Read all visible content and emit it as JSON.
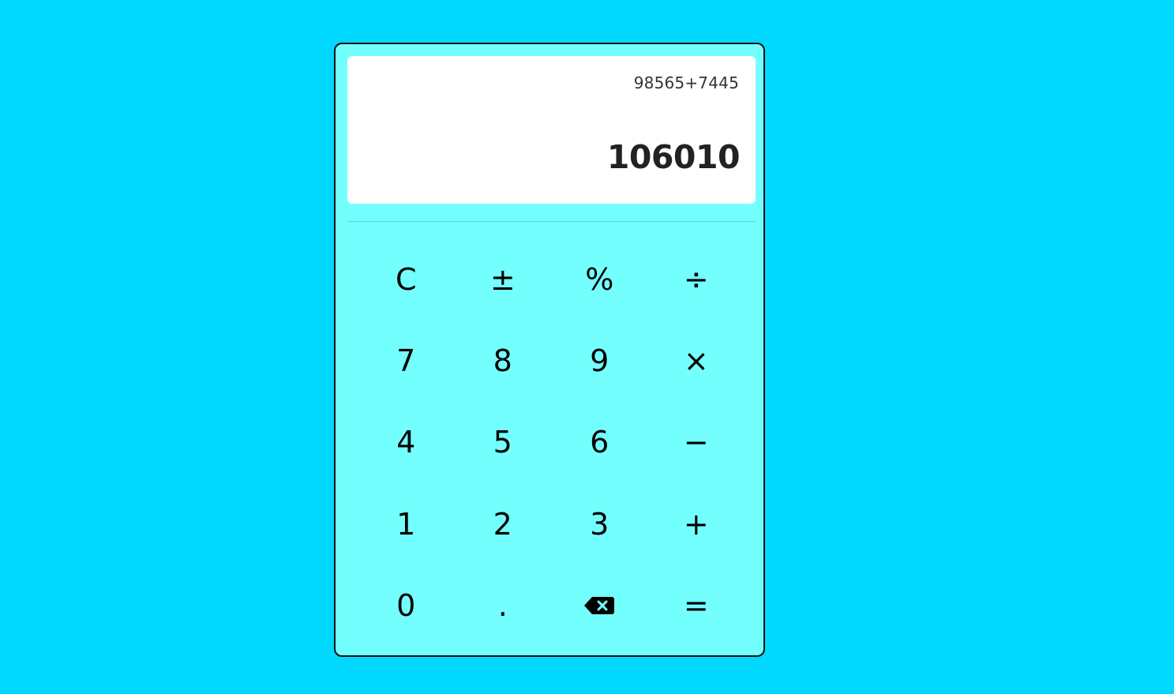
{
  "display": {
    "expression": "98565+7445",
    "result": "106010"
  },
  "keys": [
    {
      "name": "clear-button",
      "label": "C"
    },
    {
      "name": "plus-minus-button",
      "label": "±"
    },
    {
      "name": "percent-button",
      "label": "%"
    },
    {
      "name": "divide-button",
      "label": "÷"
    },
    {
      "name": "digit-7-button",
      "label": "7"
    },
    {
      "name": "digit-8-button",
      "label": "8"
    },
    {
      "name": "digit-9-button",
      "label": "9"
    },
    {
      "name": "multiply-button",
      "label": "×"
    },
    {
      "name": "digit-4-button",
      "label": "4"
    },
    {
      "name": "digit-5-button",
      "label": "5"
    },
    {
      "name": "digit-6-button",
      "label": "6"
    },
    {
      "name": "subtract-button",
      "label": "−"
    },
    {
      "name": "digit-1-button",
      "label": "1"
    },
    {
      "name": "digit-2-button",
      "label": "2"
    },
    {
      "name": "digit-3-button",
      "label": "3"
    },
    {
      "name": "add-button",
      "label": "+"
    },
    {
      "name": "digit-0-button",
      "label": "0"
    },
    {
      "name": "decimal-button",
      "label": "."
    },
    {
      "name": "backspace-button",
      "icon": "backspace-icon"
    },
    {
      "name": "equals-button",
      "label": "="
    }
  ],
  "colors": {
    "background": "#00d8ff",
    "calculator_body": "#74ffff",
    "display_bg": "#ffffff",
    "key_text": "#000000"
  }
}
